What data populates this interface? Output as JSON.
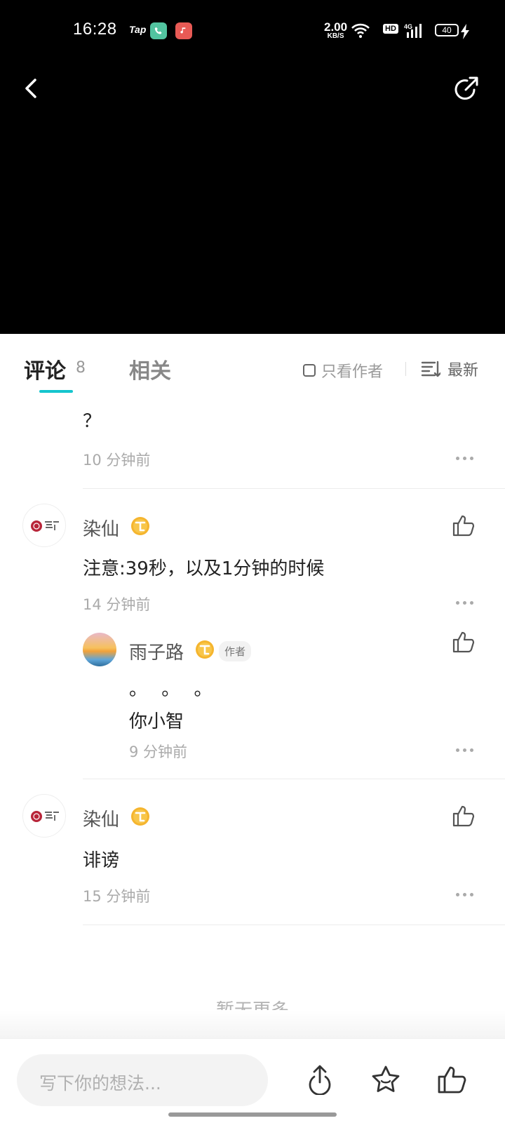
{
  "status_bar": {
    "time": "16:28",
    "tap_label": "Tap",
    "net_speed_value": "2.00",
    "net_speed_unit": "KB/S",
    "hd_label": "HD",
    "network_label": "4G",
    "battery": "40"
  },
  "tabs": {
    "comments_label": "评论",
    "comments_count": "8",
    "related_label": "相关",
    "author_only_label": "只看作者",
    "sort_label": "最新"
  },
  "comments": {
    "partial": {
      "text": "？",
      "time": "10 分钟前"
    },
    "c1": {
      "user": "染仙",
      "text": "注意:39秒，以及1分钟的时候",
      "time": "14 分钟前",
      "reply": {
        "user": "雨子路",
        "author_tag": "作者",
        "line1": "。 。 。",
        "line2": "你小智",
        "time": "9 分钟前"
      }
    },
    "c2": {
      "user": "染仙",
      "text": "诽谤",
      "time": "15 分钟前"
    }
  },
  "no_more_text": "暂无更多",
  "bottom_bar": {
    "input_placeholder": "写下你的想法..."
  },
  "colors": {
    "accent": "#15c5ce",
    "badge_gold": "#f5b52e"
  },
  "icons": [
    "back-icon",
    "share-icon",
    "like-icon",
    "more-icon",
    "upload-icon",
    "star-icon",
    "thumb-up-icon",
    "sort-icon",
    "checkbox-icon",
    "badge-icon"
  ]
}
